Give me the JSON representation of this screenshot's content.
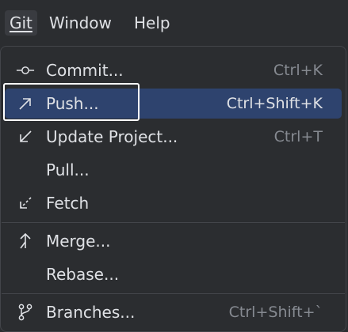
{
  "menubar": {
    "items": [
      {
        "label": "Git",
        "active": true
      },
      {
        "label": "Window",
        "active": false
      },
      {
        "label": "Help",
        "active": false
      }
    ]
  },
  "menu": {
    "items": [
      {
        "label": "Commit...",
        "shortcut": "Ctrl+K",
        "icon": "commit-icon"
      },
      {
        "label": "Push...",
        "shortcut": "Ctrl+Shift+K",
        "icon": "push-arrow-icon",
        "selected": true
      },
      {
        "label": "Update Project...",
        "shortcut": "Ctrl+T",
        "icon": "update-arrow-icon"
      },
      {
        "label": "Pull...",
        "shortcut": "",
        "icon": ""
      },
      {
        "label": "Fetch",
        "shortcut": "",
        "icon": "fetch-arrow-icon"
      },
      {
        "label": "Merge...",
        "shortcut": "",
        "icon": "merge-icon"
      },
      {
        "label": "Rebase...",
        "shortcut": "",
        "icon": ""
      },
      {
        "label": "Branches...",
        "shortcut": "Ctrl+Shift+`",
        "icon": "branches-icon"
      }
    ]
  },
  "colors": {
    "background": "#2b2d30",
    "selection": "#2e436e",
    "text": "#dfe1e5",
    "shortcut_text": "#868a91",
    "separator": "#43454a"
  }
}
